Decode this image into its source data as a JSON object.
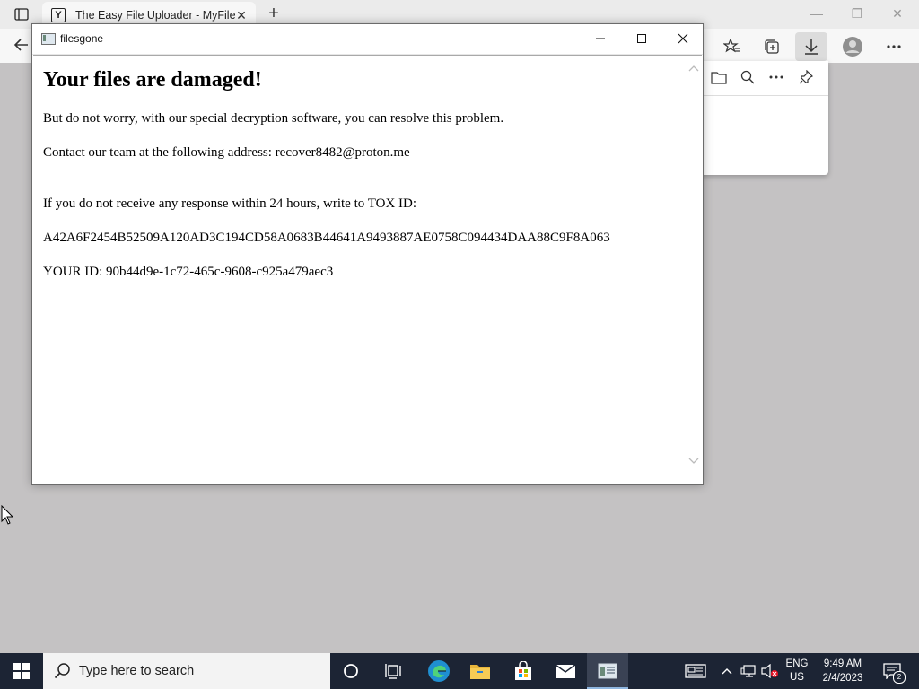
{
  "browser": {
    "tab_title": "The Easy File Uploader - MyFile",
    "tab_favicon": "Y"
  },
  "note_window": {
    "title": "filesgone",
    "heading": "Your files are damaged!",
    "lines": [
      "But do not worry, with our special decryption software, you can resolve this problem.",
      "Contact our team at the following address: recover8482@proton.me",
      "If you do not receive any response within 24 hours, write to TOX ID:",
      "A42A6F2454B52509A120AD3C194CD58A0683B44641A9493887AE0758C094434DAA88C9F8A063",
      "YOUR ID: 90b44d9e-1c72-465c-9608-c925a479aec3"
    ]
  },
  "taskbar": {
    "search_placeholder": "Type here to search",
    "lang_top": "ENG",
    "lang_bottom": "US",
    "time": "9:49 AM",
    "date": "2/4/2023",
    "notification_count": "2"
  },
  "colors": {
    "desktop_bg": "#c4c2c3",
    "taskbar_bg": "#1c2434",
    "edge_accent": "#1f8fd1"
  },
  "icons": {
    "browser": [
      "tab-actions-icon",
      "close-icon",
      "plus-icon",
      "minimize-icon",
      "restore-icon",
      "back-arrow-icon",
      "favorites-icon",
      "collections-icon",
      "download-icon",
      "profile-icon",
      "more-icon"
    ],
    "downloads_panel": [
      "folder-icon",
      "search-icon",
      "more-icon",
      "pin-icon"
    ],
    "taskbar": [
      "windows-logo-icon",
      "search-icon",
      "cortana-icon",
      "task-view-icon",
      "edge-icon",
      "file-explorer-icon",
      "store-icon",
      "mail-icon",
      "app-window-icon",
      "news-icon",
      "chevron-up-icon",
      "network-icon",
      "volume-muted-icon",
      "notifications-icon"
    ]
  }
}
